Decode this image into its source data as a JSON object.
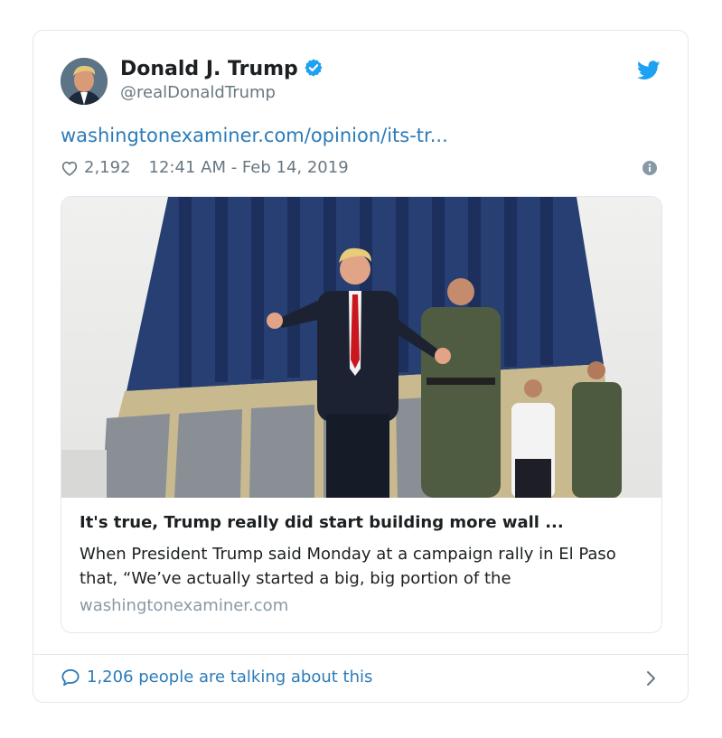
{
  "author": {
    "name": "Donald J. Trump",
    "handle": "@realDonaldTrump"
  },
  "tweet": {
    "link_text": "washingtonexaminer.com/opinion/its-tr...",
    "likes": "2,192",
    "timestamp": "12:41 AM - Feb 14, 2019"
  },
  "card": {
    "title": "It's true, Trump really did start building more wall ...",
    "description": "When President Trump said Monday at a campaign rally in El Paso that, “We’ve actually started a big, big portion of the",
    "domain": "washingtonexaminer.com"
  },
  "footer": {
    "talking": "1,206 people are talking about this"
  },
  "icons": {
    "verified": "verified-badge-icon",
    "bird": "twitter-bird-icon",
    "heart": "heart-icon",
    "info": "info-icon",
    "bubble": "speech-bubble-icon",
    "chevron": "chevron-right-icon"
  },
  "colors": {
    "link": "#2b7bb9",
    "muted": "#697882",
    "twitter_blue": "#1da1f2",
    "border": "#e1e8ed"
  }
}
